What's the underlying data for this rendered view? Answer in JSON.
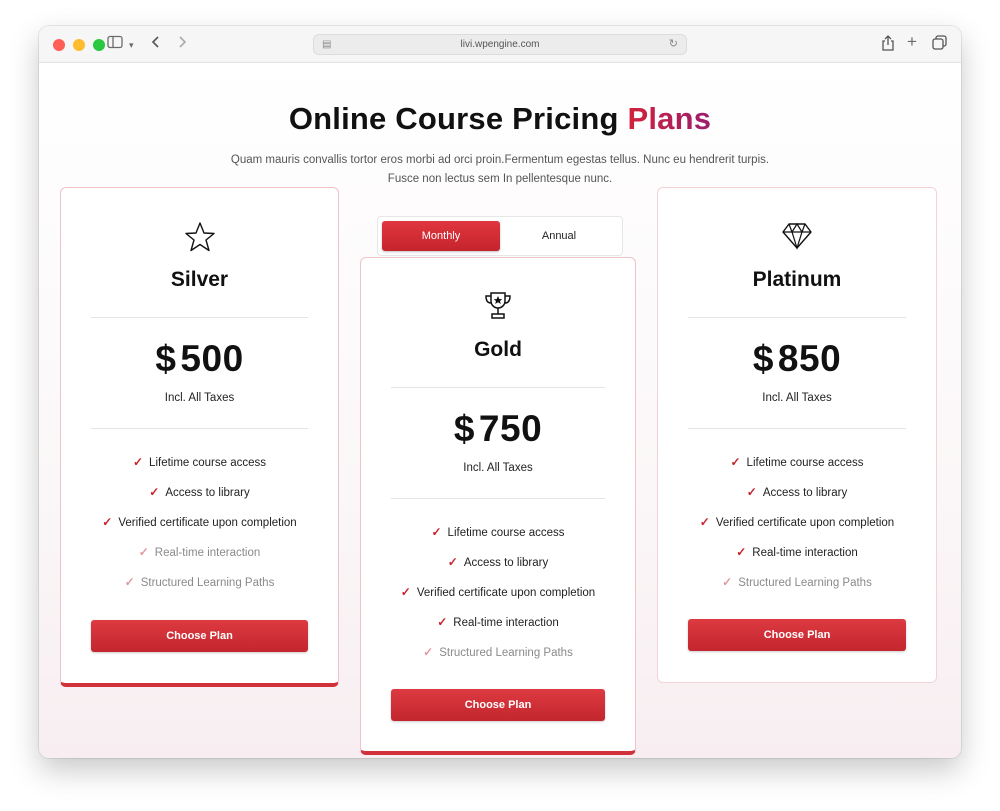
{
  "browser": {
    "url": "livi.wpengine.com",
    "light_colors": [
      "#ff5f57",
      "#febc2e",
      "#28c840"
    ]
  },
  "header": {
    "title_main": "Online Course Pricing",
    "title_accent": "Plans",
    "subtitle_line1": "Quam mauris convallis tortor eros morbi ad orci proin.Fermentum egestas tellus. Nunc eu hendrerit turpis.",
    "subtitle_line2": "Fusce non lectus sem In pellentesque nunc."
  },
  "toggle": {
    "monthly": "Monthly",
    "annual": "Annual",
    "active": "Monthly"
  },
  "plans": [
    {
      "icon": "star-icon",
      "name": "Silver",
      "currency": "$",
      "price": "500",
      "note": "Incl. All Taxes",
      "features": [
        {
          "text": "Lifetime course access",
          "included": true
        },
        {
          "text": "Access to library",
          "included": true
        },
        {
          "text": "Verified certificate upon completion",
          "included": true
        },
        {
          "text": "Real-time interaction",
          "included": false
        },
        {
          "text": "Structured Learning Paths",
          "included": false
        }
      ],
      "button": "Choose Plan"
    },
    {
      "icon": "trophy-icon",
      "name": "Gold",
      "currency": "$",
      "price": "750",
      "note": "Incl. All Taxes",
      "features": [
        {
          "text": "Lifetime course access",
          "included": true
        },
        {
          "text": "Access to library",
          "included": true
        },
        {
          "text": "Verified certificate upon completion",
          "included": true
        },
        {
          "text": "Real-time interaction",
          "included": true
        },
        {
          "text": "Structured Learning Paths",
          "included": false
        }
      ],
      "button": "Choose Plan"
    },
    {
      "icon": "diamond-icon",
      "name": "Platinum",
      "currency": "$",
      "price": "850",
      "note": "Incl. All Taxes",
      "features": [
        {
          "text": "Lifetime course access",
          "included": true
        },
        {
          "text": "Access to library",
          "included": true
        },
        {
          "text": "Verified certificate upon completion",
          "included": true
        },
        {
          "text": "Real-time interaction",
          "included": true
        },
        {
          "text": "Structured Learning Paths",
          "included": false
        }
      ],
      "button": "Choose Plan"
    }
  ],
  "colors": {
    "accent": "#d0313a",
    "check": "#c8232c",
    "check_muted": "#e09aa0"
  }
}
